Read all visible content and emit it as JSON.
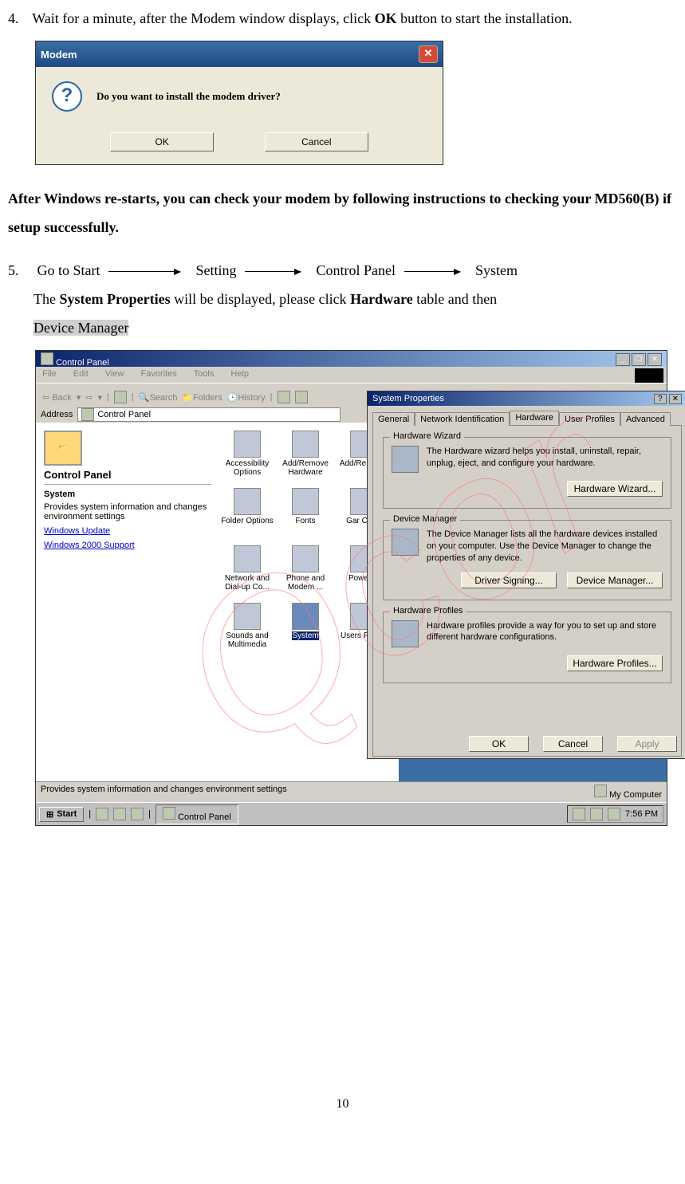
{
  "step4": {
    "num": "4.",
    "text_a": "Wait for a minute, after the Modem window displays, click ",
    "ok": "OK",
    "text_b": " button to start the installation."
  },
  "modem_dialog": {
    "title": "Modem",
    "message": "Do you want to install the modem driver?",
    "ok_btn": "OK",
    "cancel_btn": "Cancel"
  },
  "restart_text": "After Windows re-starts, you can check your modem by following instructions to checking your MD560(B) if setup successfully.",
  "step5": {
    "num": "5.",
    "goto": "Go to Start",
    "setting": "Setting",
    "cpanel": "Control Panel",
    "system": "System",
    "line2a": "The ",
    "sysprops": "System Properties",
    "line2b": " will be displayed, please click ",
    "hardware": "Hardware",
    "line2c": " table and then ",
    "devmgr": "Device Manager"
  },
  "cp": {
    "win_title": "Control Panel",
    "menu": {
      "file": "File",
      "edit": "Edit",
      "view": "View",
      "fav": "Favorites",
      "tools": "Tools",
      "help": "Help"
    },
    "toolbar": {
      "back": "Back",
      "search": "Search",
      "folders": "Folders",
      "history": "History"
    },
    "address_label": "Address",
    "address_value": "Control Panel",
    "left": {
      "title": "Control Panel",
      "system": "System",
      "desc": "Provides system information and changes environment settings",
      "link1": "Windows Update",
      "link2": "Windows 2000 Support"
    },
    "icons": [
      "Accessibility Options",
      "Add/Remove Hardware",
      "Add/Re Progr",
      "Folder Options",
      "Fonts",
      "Gar Contr",
      "Network and Dial-up Co...",
      "Phone and Modem ...",
      "Power C",
      "Sounds and Multimedia",
      "System",
      "Users Passw"
    ],
    "statusbar": "Provides system information and changes environment settings",
    "mycomputer": "My Computer"
  },
  "sp": {
    "title": "System Properties",
    "tabs": {
      "general": "General",
      "netid": "Network Identification",
      "hardware": "Hardware",
      "userprof": "User Profiles",
      "advanced": "Advanced"
    },
    "hw_wizard": {
      "legend": "Hardware Wizard",
      "text": "The Hardware wizard helps you install, uninstall, repair, unplug, eject, and configure your hardware.",
      "btn": "Hardware Wizard..."
    },
    "dev_mgr": {
      "legend": "Device Manager",
      "text": "The Device Manager lists all the hardware devices installed on your computer. Use the Device Manager to change the properties of any device.",
      "btn1": "Driver Signing...",
      "btn2": "Device Manager..."
    },
    "hw_prof": {
      "legend": "Hardware Profiles",
      "text": "Hardware profiles provide a way for you to set up and store different hardware configurations.",
      "btn": "Hardware Profiles..."
    },
    "ok": "OK",
    "cancel": "Cancel",
    "apply": "Apply"
  },
  "taskbar": {
    "start": "Start",
    "task": "Control Panel",
    "time": "7:56 PM"
  },
  "watermark": "Qcom",
  "page_number": "10"
}
